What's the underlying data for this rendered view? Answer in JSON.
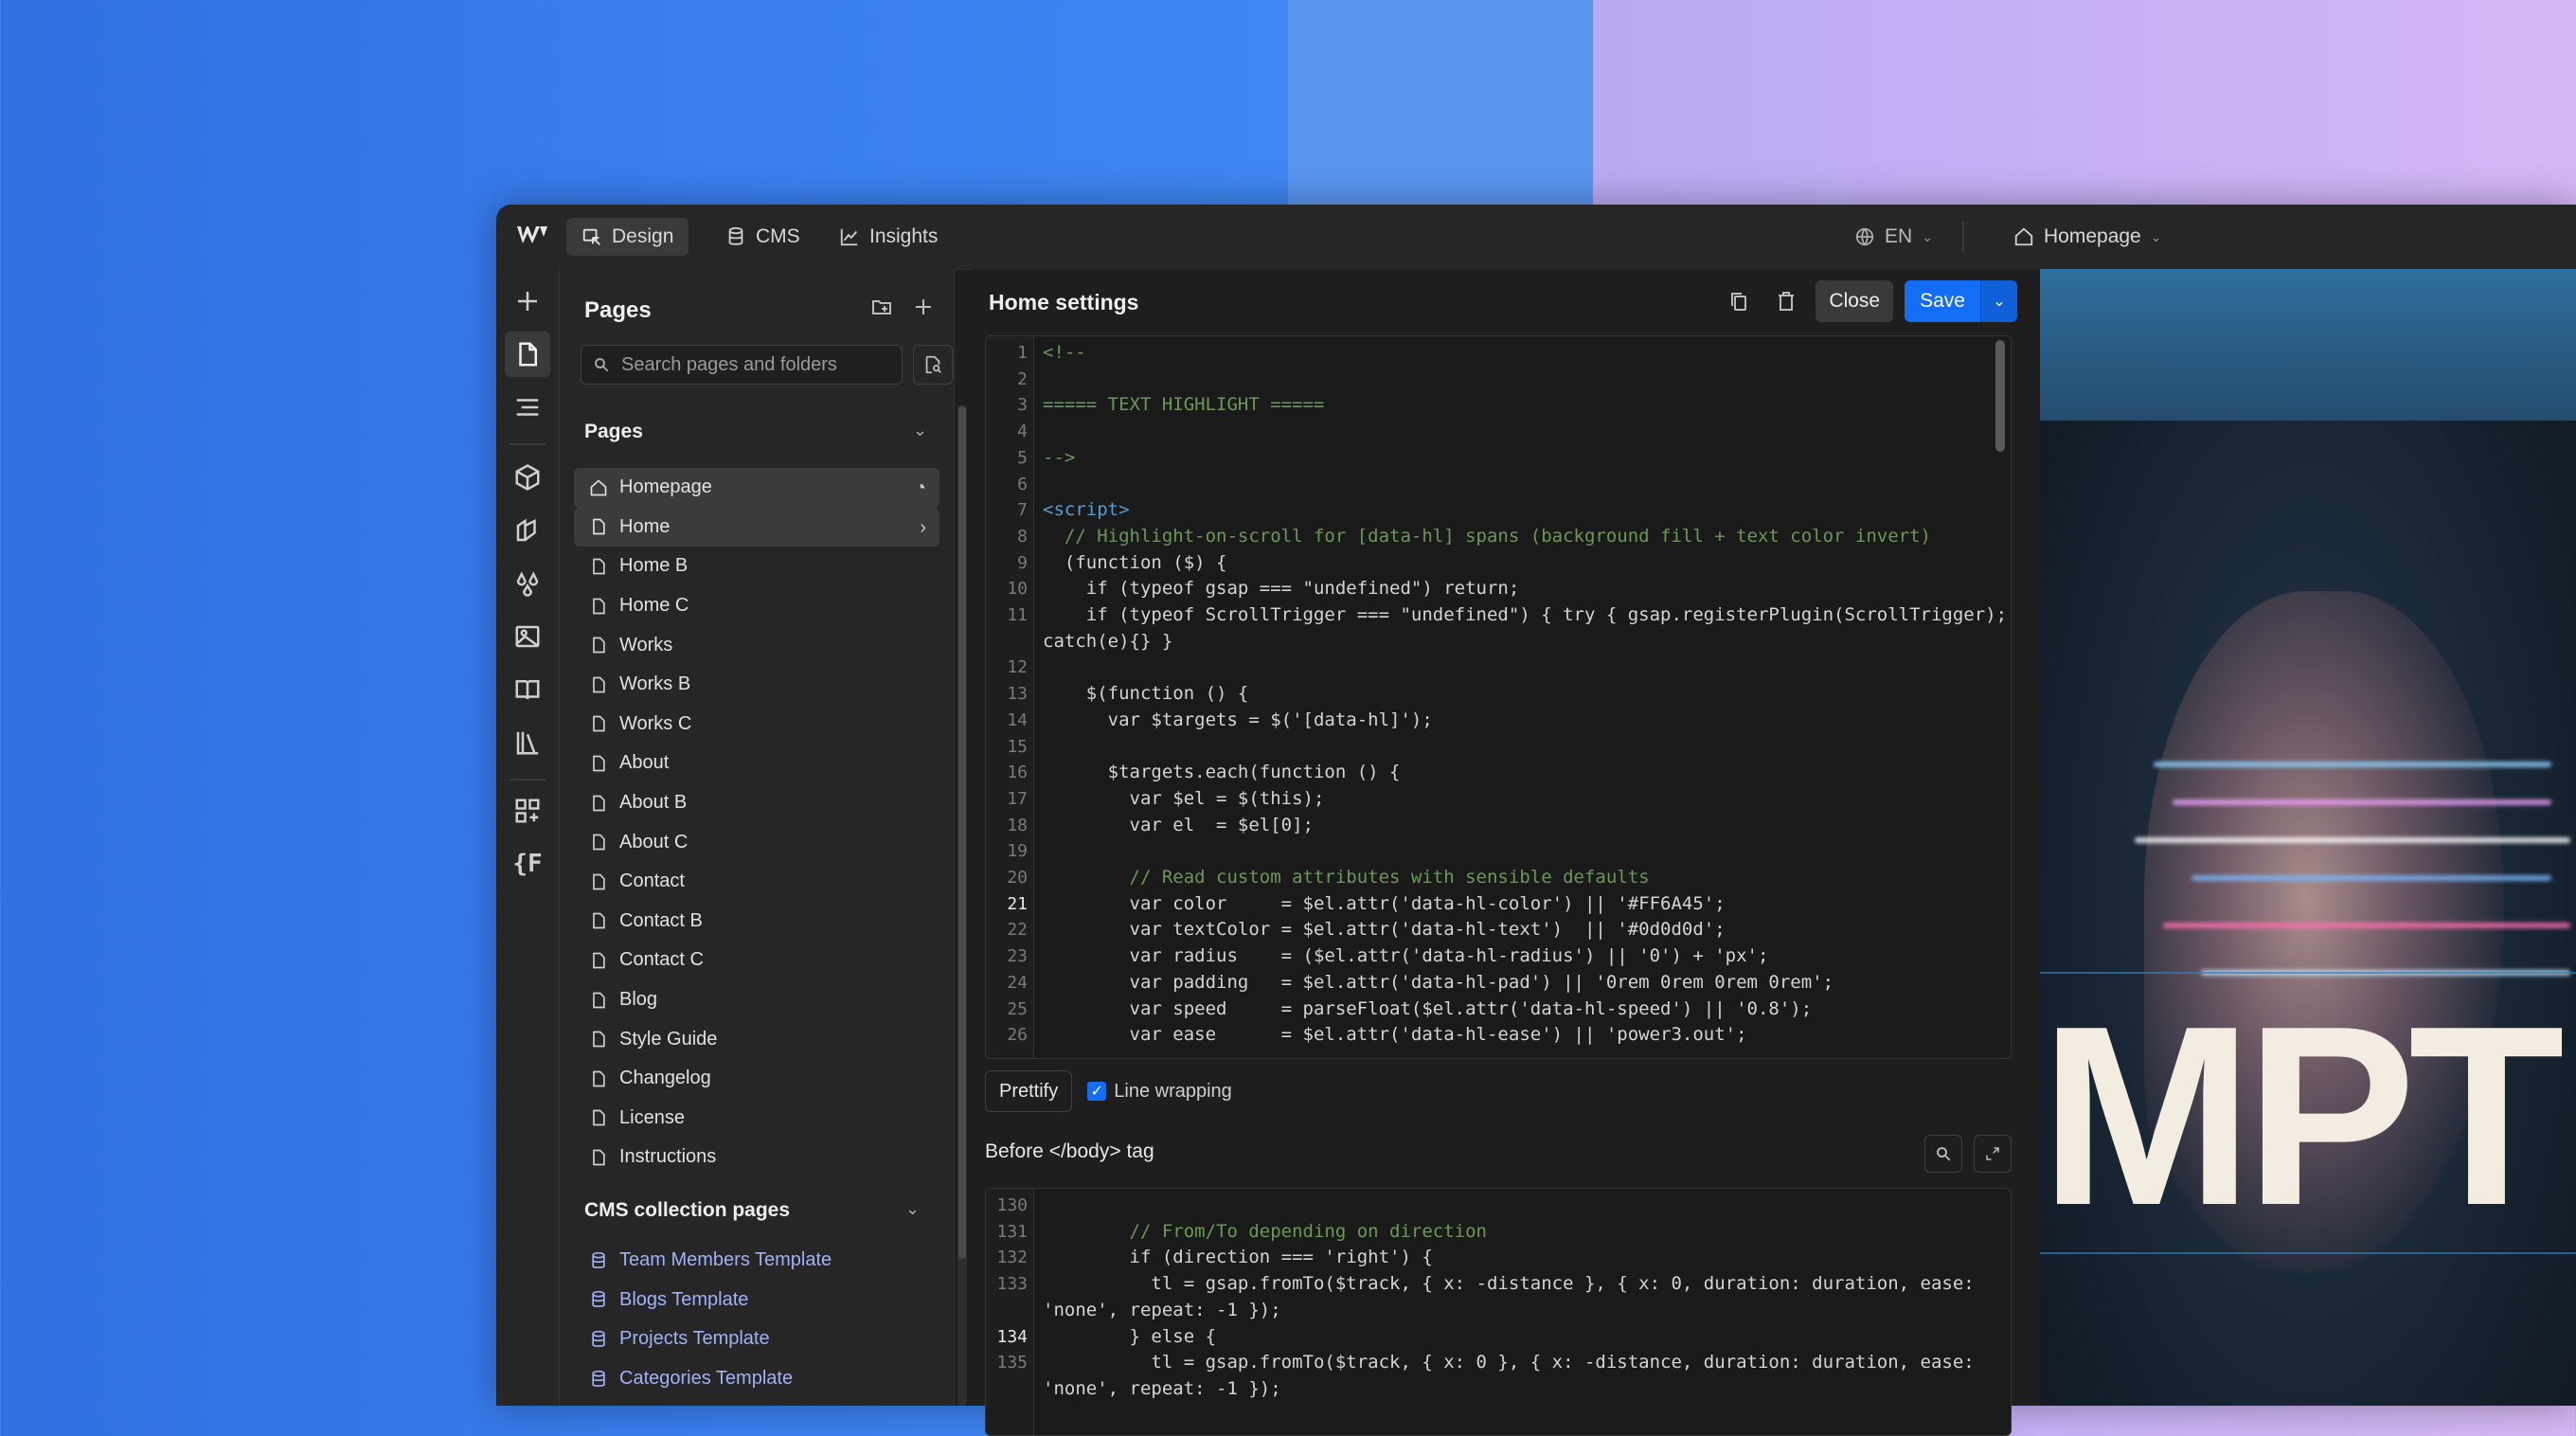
{
  "topbar": {
    "tabs": [
      {
        "label": "Design",
        "active": true
      },
      {
        "label": "CMS",
        "active": false
      },
      {
        "label": "Insights",
        "active": false
      }
    ],
    "language": "EN",
    "current_page": "Homepage"
  },
  "pages_panel": {
    "title": "Pages",
    "search_placeholder": "Search pages and folders",
    "pages_section": "Pages",
    "pages": [
      {
        "label": "Homepage",
        "icon": "home-icon"
      },
      {
        "label": "Home",
        "icon": "page-icon"
      },
      {
        "label": "Home B",
        "icon": "page-icon"
      },
      {
        "label": "Home C",
        "icon": "page-icon"
      },
      {
        "label": "Works",
        "icon": "page-icon"
      },
      {
        "label": "Works B",
        "icon": "page-icon"
      },
      {
        "label": "Works C",
        "icon": "page-icon"
      },
      {
        "label": "About",
        "icon": "page-icon"
      },
      {
        "label": "About B",
        "icon": "page-icon"
      },
      {
        "label": "About C",
        "icon": "page-icon"
      },
      {
        "label": "Contact",
        "icon": "page-icon"
      },
      {
        "label": "Contact B",
        "icon": "page-icon"
      },
      {
        "label": "Contact C",
        "icon": "page-icon"
      },
      {
        "label": "Blog",
        "icon": "page-icon"
      },
      {
        "label": "Style Guide",
        "icon": "page-icon"
      },
      {
        "label": "Changelog",
        "icon": "page-icon"
      },
      {
        "label": "License",
        "icon": "page-icon"
      },
      {
        "label": "Instructions",
        "icon": "page-icon"
      }
    ],
    "cms_section": "CMS collection pages",
    "cms_pages": [
      {
        "label": "Team Members Template"
      },
      {
        "label": "Blogs Template"
      },
      {
        "label": "Projects Template"
      },
      {
        "label": "Categories Template"
      }
    ]
  },
  "settings": {
    "title": "Home settings",
    "close_label": "Close",
    "save_label": "Save",
    "prettify_label": "Prettify",
    "line_wrapping_label": "Line wrapping",
    "before_body_title": "Before </body> tag"
  },
  "code_head": {
    "lines": [
      {
        "n": "1",
        "t": "<!--"
      },
      {
        "n": "2",
        "t": ""
      },
      {
        "n": "3",
        "t": "===== TEXT HIGHLIGHT ====="
      },
      {
        "n": "4",
        "t": ""
      },
      {
        "n": "5",
        "t": "-->"
      },
      {
        "n": "6",
        "t": ""
      },
      {
        "n": "7",
        "t": "<script>"
      },
      {
        "n": "8",
        "t": "  // Highlight-on-scroll for [data-hl] spans (background fill + text color invert)"
      },
      {
        "n": "9",
        "t": "  (function ($) {"
      },
      {
        "n": "10",
        "t": "    if (typeof gsap === \"undefined\") return;"
      },
      {
        "n": "11",
        "t": "    if (typeof ScrollTrigger === \"undefined\") { try { gsap.registerPlugin(ScrollTrigger); }"
      },
      {
        "n": "",
        "t": "catch(e){} }"
      },
      {
        "n": "12",
        "t": ""
      },
      {
        "n": "13",
        "t": "    $(function () {"
      },
      {
        "n": "14",
        "t": "      var $targets = $('[data-hl]');"
      },
      {
        "n": "15",
        "t": ""
      },
      {
        "n": "16",
        "t": "      $targets.each(function () {"
      },
      {
        "n": "17",
        "t": "        var $el = $(this);"
      },
      {
        "n": "18",
        "t": "        var el  = $el[0];"
      },
      {
        "n": "19",
        "t": ""
      },
      {
        "n": "20",
        "t": "        // Read custom attributes with sensible defaults"
      },
      {
        "n": "21",
        "t": "        var color     = $el.attr('data-hl-color') || '#FF6A45';"
      },
      {
        "n": "22",
        "t": "        var textColor = $el.attr('data-hl-text')  || '#0d0d0d';"
      },
      {
        "n": "23",
        "t": "        var radius    = ($el.attr('data-hl-radius') || '0') + 'px';"
      },
      {
        "n": "24",
        "t": "        var padding   = $el.attr('data-hl-pad') || '0rem 0rem 0rem 0rem';"
      },
      {
        "n": "25",
        "t": "        var speed     = parseFloat($el.attr('data-hl-speed') || '0.8');"
      },
      {
        "n": "26",
        "t": "        var ease      = $el.attr('data-hl-ease') || 'power3.out';"
      }
    ]
  },
  "code_body": {
    "lines": [
      {
        "n": "130",
        "t": ""
      },
      {
        "n": "131",
        "t": "        // From/To depending on direction"
      },
      {
        "n": "132",
        "t": "        if (direction === 'right') {"
      },
      {
        "n": "133",
        "t": "          tl = gsap.fromTo($track, { x: -distance }, { x: 0, duration: duration, ease:"
      },
      {
        "n": "",
        "t": "'none', repeat: -1 });"
      },
      {
        "n": "134",
        "t": "        } else {"
      },
      {
        "n": "135",
        "t": "          tl = gsap.fromTo($track, { x: 0 }, { x: -distance, duration: duration, ease:"
      },
      {
        "n": "",
        "t": "'none', repeat: -1 });"
      }
    ]
  },
  "preview": {
    "visible_text": "MPT"
  }
}
